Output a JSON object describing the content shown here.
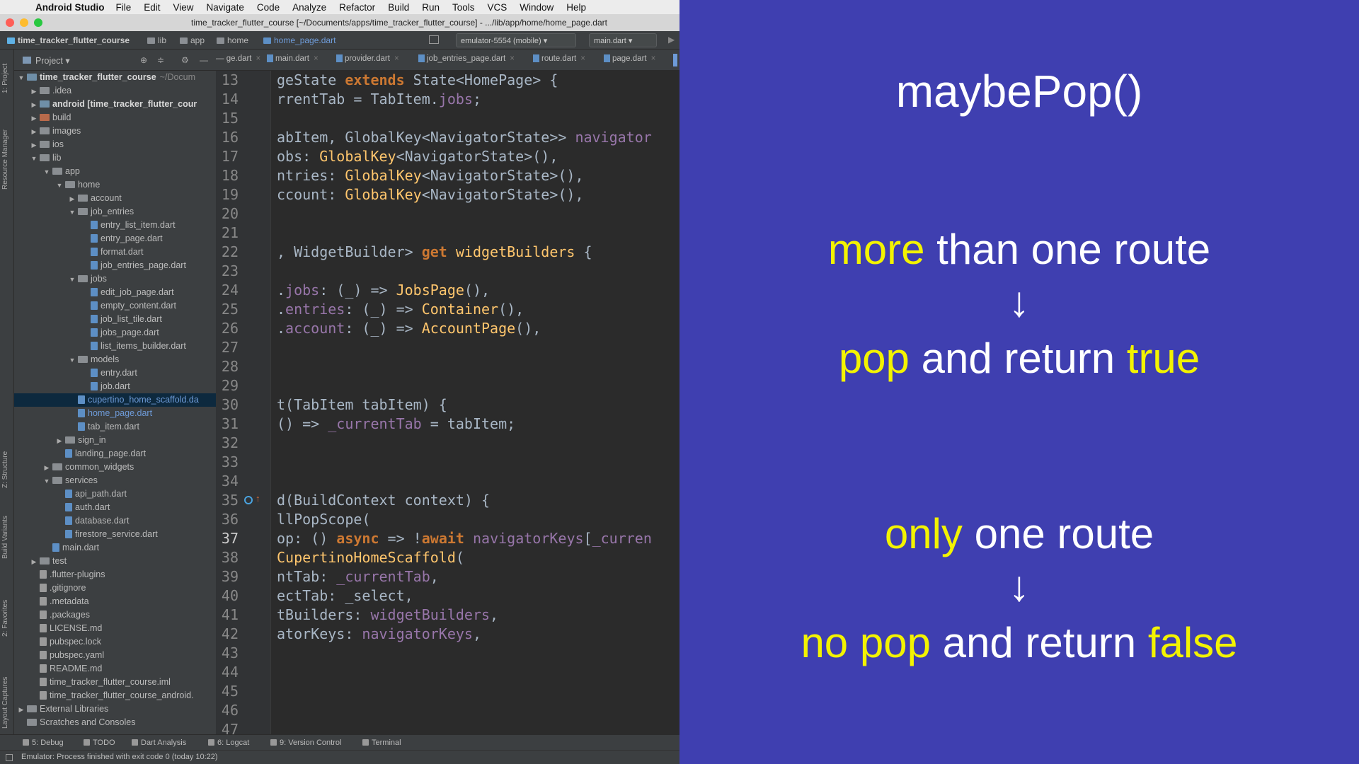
{
  "menubar": {
    "app_name": "Android Studio",
    "items": [
      "File",
      "Edit",
      "View",
      "Navigate",
      "Code",
      "Analyze",
      "Refactor",
      "Build",
      "Run",
      "Tools",
      "VCS",
      "Window",
      "Help"
    ]
  },
  "window": {
    "title": "time_tracker_flutter_course [~/Documents/apps/time_tracker_flutter_course] - .../lib/app/home/home_page.dart"
  },
  "breadcrumb": [
    "time_tracker_flutter_course",
    "lib",
    "app",
    "home",
    "home_page.dart"
  ],
  "run_config": {
    "device": "emulator-5554 (mobile)",
    "target": "main.dart"
  },
  "project_panel": {
    "label": "Project",
    "tree": [
      {
        "depth": 0,
        "arrow": "▼",
        "kind": "module",
        "name": "time_tracker_flutter_course",
        "suffix": "~/Docum",
        "bold": true
      },
      {
        "depth": 1,
        "arrow": "▶",
        "kind": "folder",
        "name": ".idea"
      },
      {
        "depth": 1,
        "arrow": "▶",
        "kind": "module",
        "name": "android [time_tracker_flutter_cour",
        "bold": true
      },
      {
        "depth": 1,
        "arrow": "▶",
        "kind": "excluded",
        "name": "build"
      },
      {
        "depth": 1,
        "arrow": "▶",
        "kind": "folder",
        "name": "images"
      },
      {
        "depth": 1,
        "arrow": "▶",
        "kind": "folder",
        "name": "ios"
      },
      {
        "depth": 1,
        "arrow": "▼",
        "kind": "folder",
        "name": "lib"
      },
      {
        "depth": 2,
        "arrow": "▼",
        "kind": "folder",
        "name": "app"
      },
      {
        "depth": 3,
        "arrow": "▼",
        "kind": "folder",
        "name": "home"
      },
      {
        "depth": 4,
        "arrow": "▶",
        "kind": "folder",
        "name": "account"
      },
      {
        "depth": 4,
        "arrow": "▼",
        "kind": "folder",
        "name": "job_entries"
      },
      {
        "depth": 5,
        "arrow": "",
        "kind": "dart",
        "name": "entry_list_item.dart"
      },
      {
        "depth": 5,
        "arrow": "",
        "kind": "dart",
        "name": "entry_page.dart"
      },
      {
        "depth": 5,
        "arrow": "",
        "kind": "dart",
        "name": "format.dart"
      },
      {
        "depth": 5,
        "arrow": "",
        "kind": "dart",
        "name": "job_entries_page.dart"
      },
      {
        "depth": 4,
        "arrow": "▼",
        "kind": "folder",
        "name": "jobs"
      },
      {
        "depth": 5,
        "arrow": "",
        "kind": "dart",
        "name": "edit_job_page.dart"
      },
      {
        "depth": 5,
        "arrow": "",
        "kind": "dart",
        "name": "empty_content.dart"
      },
      {
        "depth": 5,
        "arrow": "",
        "kind": "dart",
        "name": "job_list_tile.dart"
      },
      {
        "depth": 5,
        "arrow": "",
        "kind": "dart",
        "name": "jobs_page.dart"
      },
      {
        "depth": 5,
        "arrow": "",
        "kind": "dart",
        "name": "list_items_builder.dart"
      },
      {
        "depth": 4,
        "arrow": "▼",
        "kind": "folder",
        "name": "models"
      },
      {
        "depth": 5,
        "arrow": "",
        "kind": "dart",
        "name": "entry.dart"
      },
      {
        "depth": 5,
        "arrow": "",
        "kind": "dart",
        "name": "job.dart"
      },
      {
        "depth": 4,
        "arrow": "",
        "kind": "dart",
        "name": "cupertino_home_scaffold.da",
        "selected": true,
        "blue": true
      },
      {
        "depth": 4,
        "arrow": "",
        "kind": "dart",
        "name": "home_page.dart",
        "blue": true
      },
      {
        "depth": 4,
        "arrow": "",
        "kind": "dart",
        "name": "tab_item.dart"
      },
      {
        "depth": 3,
        "arrow": "▶",
        "kind": "folder",
        "name": "sign_in"
      },
      {
        "depth": 3,
        "arrow": "",
        "kind": "dart",
        "name": "landing_page.dart"
      },
      {
        "depth": 2,
        "arrow": "▶",
        "kind": "folder",
        "name": "common_widgets"
      },
      {
        "depth": 2,
        "arrow": "▼",
        "kind": "folder",
        "name": "services"
      },
      {
        "depth": 3,
        "arrow": "",
        "kind": "dart",
        "name": "api_path.dart"
      },
      {
        "depth": 3,
        "arrow": "",
        "kind": "dart",
        "name": "auth.dart"
      },
      {
        "depth": 3,
        "arrow": "",
        "kind": "dart",
        "name": "database.dart"
      },
      {
        "depth": 3,
        "arrow": "",
        "kind": "dart",
        "name": "firestore_service.dart"
      },
      {
        "depth": 2,
        "arrow": "",
        "kind": "dart",
        "name": "main.dart"
      },
      {
        "depth": 1,
        "arrow": "▶",
        "kind": "folder",
        "name": "test"
      },
      {
        "depth": 1,
        "arrow": "",
        "kind": "plain",
        "name": ".flutter-plugins"
      },
      {
        "depth": 1,
        "arrow": "",
        "kind": "plain",
        "name": ".gitignore"
      },
      {
        "depth": 1,
        "arrow": "",
        "kind": "plain",
        "name": ".metadata"
      },
      {
        "depth": 1,
        "arrow": "",
        "kind": "plain",
        "name": ".packages"
      },
      {
        "depth": 1,
        "arrow": "",
        "kind": "plain",
        "name": "LICENSE.md"
      },
      {
        "depth": 1,
        "arrow": "",
        "kind": "plain",
        "name": "pubspec.lock"
      },
      {
        "depth": 1,
        "arrow": "",
        "kind": "plain",
        "name": "pubspec.yaml"
      },
      {
        "depth": 1,
        "arrow": "",
        "kind": "plain",
        "name": "README.md"
      },
      {
        "depth": 1,
        "arrow": "",
        "kind": "plain",
        "name": "time_tracker_flutter_course.iml"
      },
      {
        "depth": 1,
        "arrow": "",
        "kind": "plain",
        "name": "time_tracker_flutter_course_android."
      },
      {
        "depth": 0,
        "arrow": "▶",
        "kind": "folder",
        "name": "External Libraries"
      },
      {
        "depth": 0,
        "arrow": "",
        "kind": "folder",
        "name": "Scratches and Consoles"
      }
    ]
  },
  "editor_tabs": [
    "ge.dart",
    "main.dart",
    "provider.dart",
    "job_entries_page.dart",
    "route.dart",
    "page.dart"
  ],
  "side_tabs": [
    "1: Project",
    "Resource Manager",
    "Z: Structure",
    "Build Variants",
    "2: Favorites",
    "Layout Captures"
  ],
  "editor": {
    "lines": [
      {
        "n": "13",
        "code": [
          [
            "",
            "geState "
          ],
          [
            "kw",
            "extends"
          ],
          [
            "",
            " State<HomePage> {"
          ]
        ]
      },
      {
        "n": "14",
        "code": [
          [
            "",
            "rrentTab = TabItem."
          ],
          [
            "prop",
            "jobs"
          ],
          [
            "",
            ";"
          ]
        ]
      },
      {
        "n": "15",
        "code": []
      },
      {
        "n": "16",
        "code": [
          [
            "",
            "abItem, GlobalKey<NavigatorState>> "
          ],
          [
            "prop",
            "navigator"
          ]
        ]
      },
      {
        "n": "17",
        "code": [
          [
            "",
            "obs: "
          ],
          [
            "type",
            "GlobalKey"
          ],
          [
            "",
            "<NavigatorState>(),"
          ]
        ]
      },
      {
        "n": "18",
        "code": [
          [
            "",
            "ntries: "
          ],
          [
            "type",
            "GlobalKey"
          ],
          [
            "",
            "<NavigatorState>(),"
          ]
        ]
      },
      {
        "n": "19",
        "code": [
          [
            "",
            "ccount: "
          ],
          [
            "type",
            "GlobalKey"
          ],
          [
            "",
            "<NavigatorState>(),"
          ]
        ]
      },
      {
        "n": "20",
        "code": []
      },
      {
        "n": "21",
        "code": []
      },
      {
        "n": "22",
        "code": [
          [
            "",
            ", WidgetBuilder> "
          ],
          [
            "kw",
            "get"
          ],
          [
            "",
            " "
          ],
          [
            "cls",
            "widgetBuilders"
          ],
          [
            "",
            " {"
          ]
        ]
      },
      {
        "n": "23",
        "code": []
      },
      {
        "n": "24",
        "code": [
          [
            "",
            "."
          ],
          [
            "prop",
            "jobs"
          ],
          [
            "",
            ": (_) => "
          ],
          [
            "type",
            "JobsPage"
          ],
          [
            "",
            "(),"
          ]
        ]
      },
      {
        "n": "25",
        "code": [
          [
            "",
            "."
          ],
          [
            "prop",
            "entries"
          ],
          [
            "",
            ": (_) => "
          ],
          [
            "type",
            "Container"
          ],
          [
            "",
            "(),"
          ]
        ]
      },
      {
        "n": "26",
        "code": [
          [
            "",
            "."
          ],
          [
            "prop",
            "account"
          ],
          [
            "",
            ": (_) => "
          ],
          [
            "type",
            "AccountPage"
          ],
          [
            "",
            "(),"
          ]
        ]
      },
      {
        "n": "27",
        "code": []
      },
      {
        "n": "28",
        "code": []
      },
      {
        "n": "29",
        "code": []
      },
      {
        "n": "30",
        "code": [
          [
            "",
            "t(TabItem tabItem) {"
          ]
        ]
      },
      {
        "n": "31",
        "code": [
          [
            "",
            "() => "
          ],
          [
            "prop",
            "_currentTab"
          ],
          [
            "",
            " = tabItem;"
          ]
        ]
      },
      {
        "n": "32",
        "code": []
      },
      {
        "n": "33",
        "code": []
      },
      {
        "n": "34",
        "code": []
      },
      {
        "n": "35",
        "code": [
          [
            "",
            "d(BuildContext context) {"
          ]
        ]
      },
      {
        "n": "36",
        "code": [
          [
            "",
            "llPopScope("
          ]
        ]
      },
      {
        "n": "37",
        "code": [
          [
            "",
            "op: () "
          ],
          [
            "kw",
            "async"
          ],
          [
            "",
            " => !"
          ],
          [
            "kw",
            "await"
          ],
          [
            "",
            " "
          ],
          [
            "prop",
            "navigatorKeys"
          ],
          [
            "",
            "["
          ],
          [
            "prop",
            "_curren"
          ]
        ]
      },
      {
        "n": "38",
        "code": [
          [
            "type",
            "CupertinoHomeScaffold"
          ],
          [
            "",
            "("
          ]
        ]
      },
      {
        "n": "39",
        "code": [
          [
            "",
            "ntTab: "
          ],
          [
            "prop",
            "_currentTab"
          ],
          [
            "",
            ","
          ]
        ]
      },
      {
        "n": "40",
        "code": [
          [
            "",
            "ectTab: _select,"
          ]
        ]
      },
      {
        "n": "41",
        "code": [
          [
            "",
            "tBuilders: "
          ],
          [
            "prop",
            "widgetBuilders"
          ],
          [
            "",
            ","
          ]
        ]
      },
      {
        "n": "42",
        "code": [
          [
            "",
            "atorKeys: "
          ],
          [
            "prop",
            "navigatorKeys"
          ],
          [
            "",
            ","
          ]
        ]
      },
      {
        "n": "43",
        "code": []
      },
      {
        "n": "44",
        "code": []
      },
      {
        "n": "45",
        "code": []
      },
      {
        "n": "46",
        "code": []
      },
      {
        "n": "47",
        "code": []
      }
    ],
    "current_line": "37"
  },
  "bottom_tabs": [
    "5: Debug",
    "TODO",
    "Dart Analysis",
    "6: Logcat",
    "9: Version Control",
    "Terminal"
  ],
  "status": "Emulator: Process finished with exit code 0 (today 10:22)",
  "slide": {
    "title": "maybePop()",
    "block1": {
      "l1_hl": "more",
      "l1_rest": " than one route",
      "arrow": "↓",
      "l2_hl1": "pop",
      "l2_mid": " and return ",
      "l2_hl2": "true"
    },
    "block2": {
      "l1_hl": "only",
      "l1_rest": " one route",
      "arrow": "↓",
      "l2_hl1": "no pop",
      "l2_mid": " and return ",
      "l2_hl2": "false"
    }
  },
  "colors": {
    "slide_bg": "#3f3fb0",
    "slide_highlight": "#f3f300",
    "editor_bg": "#2b2b2b",
    "panel_bg": "#3c3f41"
  }
}
